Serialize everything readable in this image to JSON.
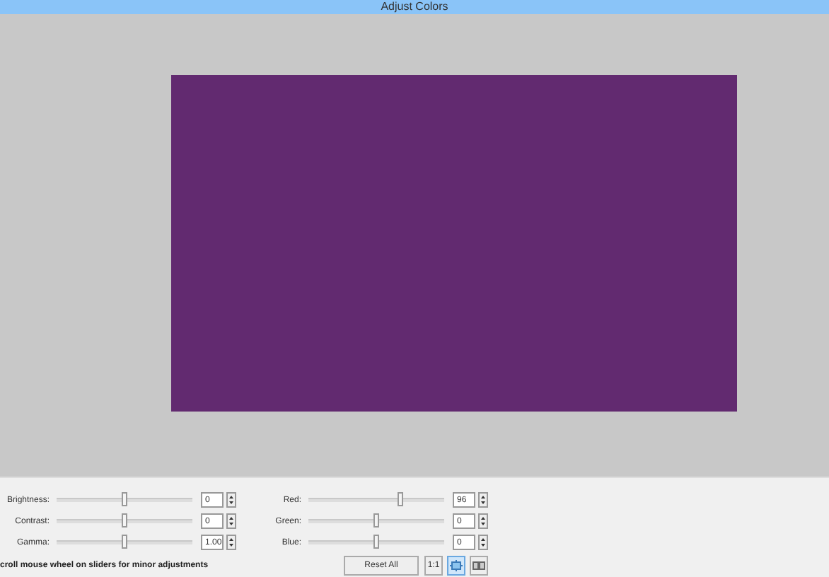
{
  "window": {
    "title": "Adjust Colors"
  },
  "left_sliders": [
    {
      "label": "Brightness:",
      "value": "0",
      "level": 0.5
    },
    {
      "label": "Contrast:",
      "value": "0",
      "level": 0.5
    },
    {
      "label": "Gamma:",
      "value": "1.00",
      "level": 0.5
    }
  ],
  "right_sliders": [
    {
      "label": "Red:",
      "value": "96",
      "level": 0.68
    },
    {
      "label": "Green:",
      "value": "0",
      "level": 0.5
    },
    {
      "label": "Blue:",
      "value": "0",
      "level": 0.5
    }
  ],
  "hint": "croll mouse wheel on sliders for minor adjustments",
  "reset_button": "Reset All",
  "view_buttons": [
    {
      "kind": "text",
      "label": "1:1",
      "selected": false
    },
    {
      "kind": "fit",
      "selected": true
    },
    {
      "kind": "split",
      "selected": false
    }
  ]
}
